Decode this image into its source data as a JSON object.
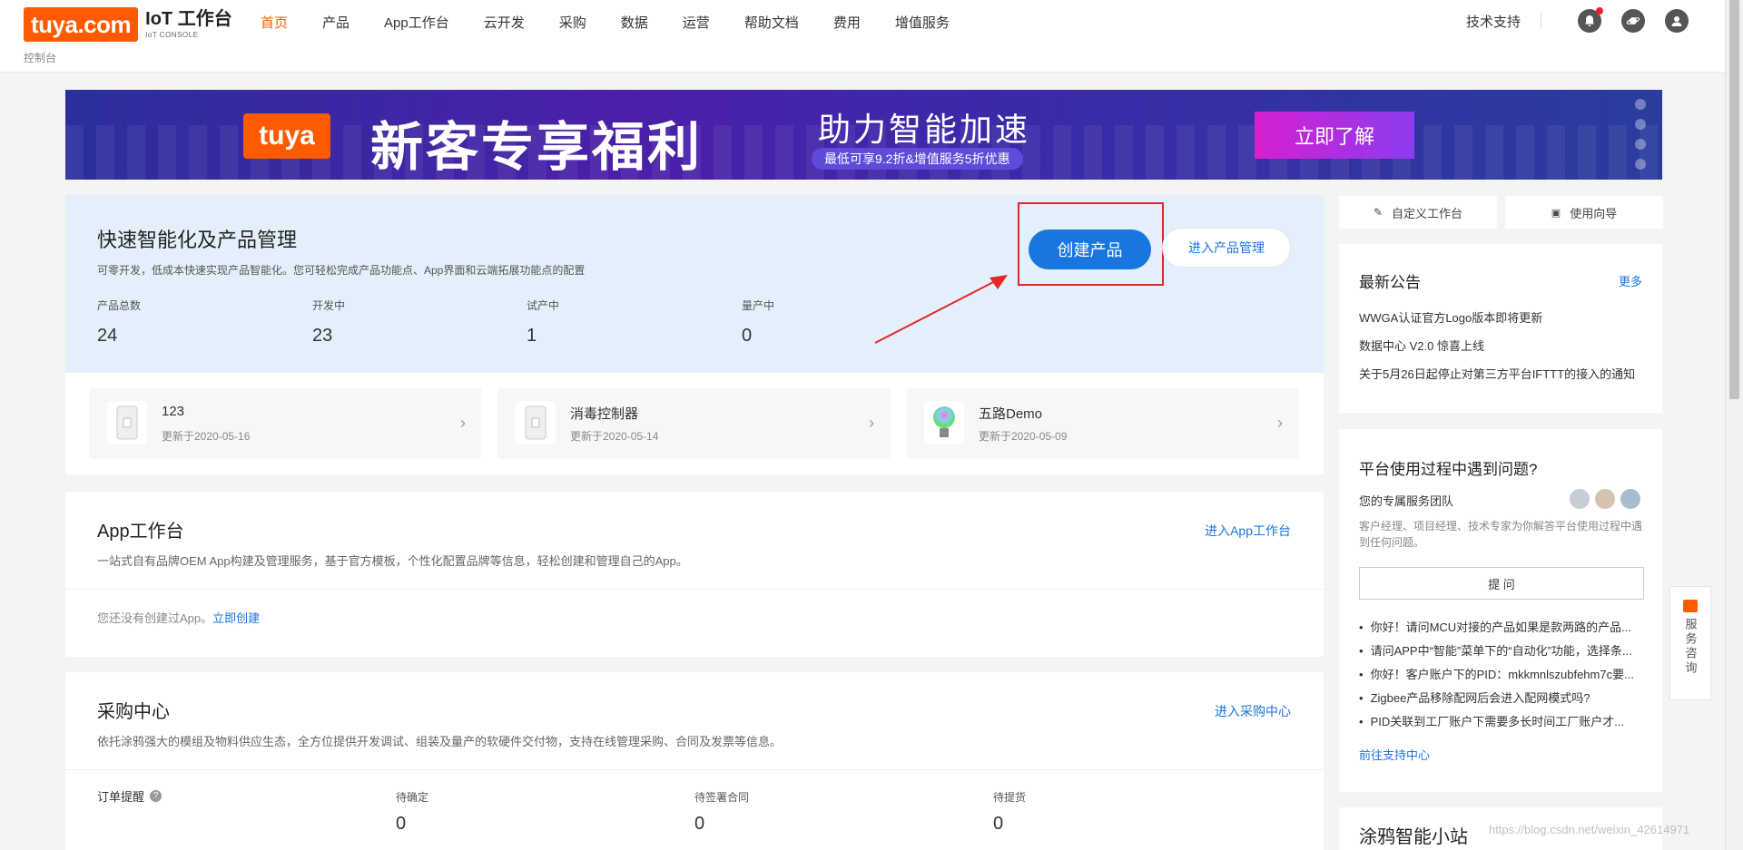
{
  "header": {
    "logo_brand": "tuya.com",
    "logo_title": "IoT 工作台",
    "logo_sub": "IoT CONSOLE",
    "nav": [
      "首页",
      "产品",
      "App工作台",
      "云开发",
      "采购",
      "数据",
      "运营",
      "帮助文档",
      "费用",
      "增值服务"
    ],
    "breadcrumb": "控制台",
    "support": "技术支持"
  },
  "banner": {
    "logo": "tuya",
    "title": "新客专享福利",
    "subtitle": "助力智能加速",
    "pill": "最低可享9.2折&增值服务5折优惠",
    "cta": "立即了解"
  },
  "hero": {
    "title": "快速智能化及产品管理",
    "desc": "可零开发，低成本快速实现产品智能化。您可轻松完成产品功能点、App界面和云端拓展功能点的配置",
    "stats": [
      {
        "label": "产品总数",
        "value": "24"
      },
      {
        "label": "开发中",
        "value": "23"
      },
      {
        "label": "试产中",
        "value": "1"
      },
      {
        "label": "量产中",
        "value": "0"
      }
    ],
    "create_btn": "创建产品",
    "manage_btn": "进入产品管理"
  },
  "products": [
    {
      "name": "123",
      "date": "更新于2020-05-16"
    },
    {
      "name": "消毒控制器",
      "date": "更新于2020-05-14"
    },
    {
      "name": "五路Demo",
      "date": "更新于2020-05-09"
    }
  ],
  "app_card": {
    "title": "App工作台",
    "link": "进入App工作台",
    "desc": "一站式自有品牌OEM App构建及管理服务，基于官方模板，个性化配置品牌等信息，轻松创建和管理自己的App。",
    "empty": "您还没有创建过App。",
    "empty_link": "立即创建"
  },
  "purchase_card": {
    "title": "采购中心",
    "link": "进入采购中心",
    "desc": "依托涂鸦强大的模组及物料供应生态，全方位提供开发调试、组装及量产的软硬件交付物，支持在线管理采购、合同及发票等信息。",
    "order_label": "订单提醒",
    "stats": [
      {
        "label": "待确定",
        "value": "0"
      },
      {
        "label": "待签署合同",
        "value": "0"
      },
      {
        "label": "待提货",
        "value": "0"
      }
    ]
  },
  "sidebar": {
    "custom_btn": "自定义工作台",
    "guide_btn": "使用向导",
    "notice_title": "最新公告",
    "notice_more": "更多",
    "notices": [
      "WWGA认证官方Logo版本即将更新",
      "数据中心 V2.0 惊喜上线",
      "关于5月26日起停止对第三方平台IFTTT的接入的通知"
    ],
    "help_title": "平台使用过程中遇到问题?",
    "team_label": "您的专属服务团队",
    "team_desc": "客户经理、项目经理、技术专家为你解答平台使用过程中遇到任何问题。",
    "ask_btn": "提 问",
    "questions": [
      "你好！请问MCU对接的产品如果是款两路的产品...",
      "请问APP中“智能”菜单下的“自动化”功能，选择条...",
      "你好！客户账户下的PID：mkkmnlszubfehm7c要...",
      "Zigbee产品移除配网后会进入配网模式吗?",
      "PID关联到工厂账户下需要多长时间工厂账户才..."
    ],
    "support_link": "前往支持中心",
    "station_title": "涂鸦智能小站"
  },
  "float_service": "服务咨询",
  "watermark": "https://blog.csdn.net/weixin_42614971",
  "colors": {
    "accent": "#ff5a00",
    "primary": "#1976e0",
    "highlight": "#e5262a"
  }
}
